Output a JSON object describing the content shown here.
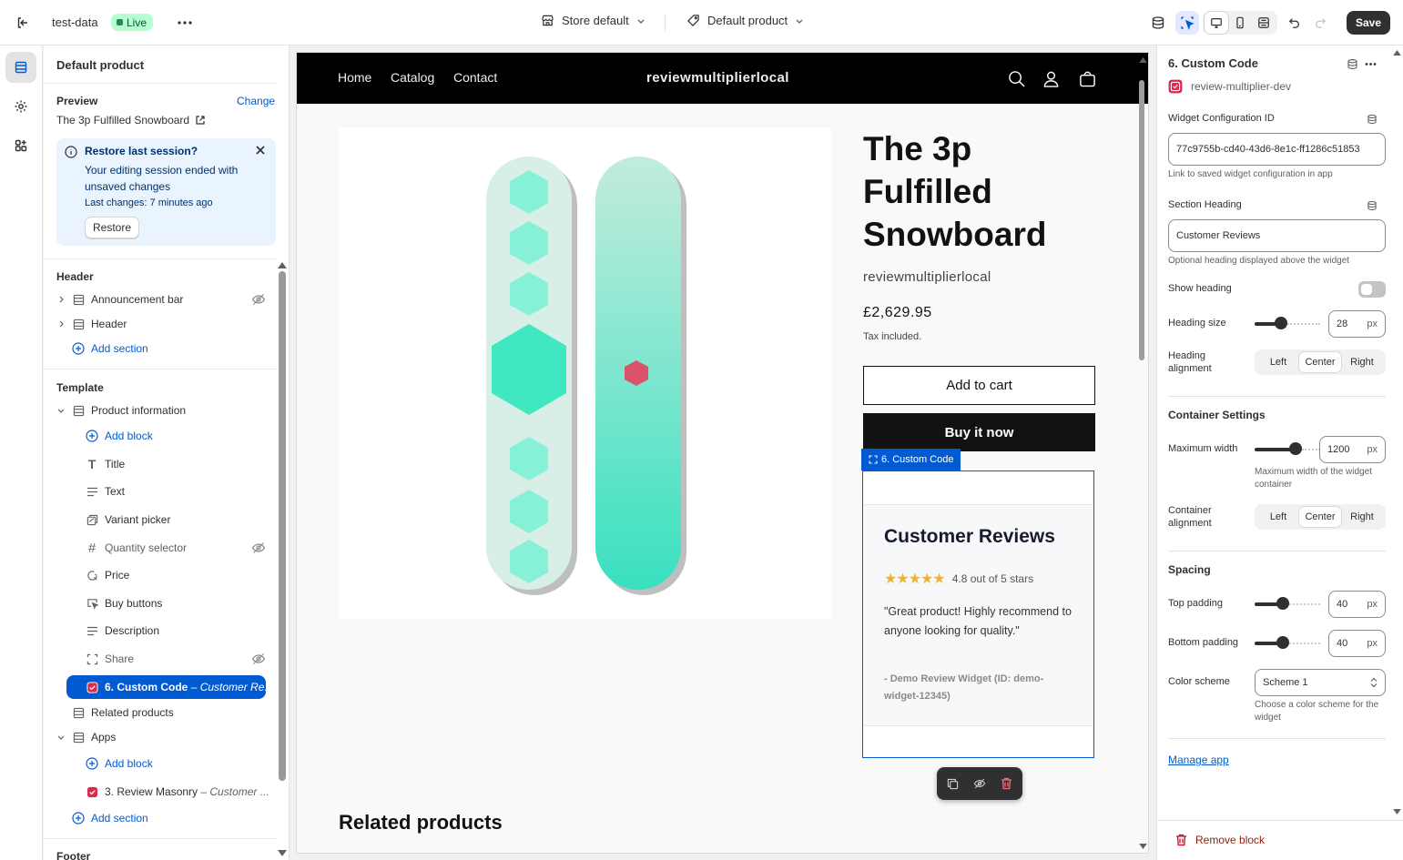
{
  "topbar": {
    "store_name": "test-data",
    "status_badge": "Live",
    "store_selector": "Store default",
    "template_selector": "Default product",
    "save_label": "Save"
  },
  "left_panel": {
    "title": "Default product",
    "preview_label": "Preview",
    "change_link": "Change",
    "preview_product": "The 3p Fulfilled Snowboard",
    "notice": {
      "title": "Restore last session?",
      "body": "Your editing session ended with unsaved changes",
      "meta": "Last changes: 7 minutes ago",
      "button": "Restore"
    },
    "header_group": {
      "title": "Header",
      "items": [
        "Announcement bar",
        "Header"
      ],
      "add_section": "Add section"
    },
    "template_group": {
      "title": "Template",
      "section": "Product information",
      "add_block": "Add block",
      "blocks": [
        "Title",
        "Text",
        "Variant picker",
        "Quantity selector",
        "Price",
        "Buy buttons",
        "Description",
        "Share"
      ],
      "selected_block": "6. Custom Code",
      "selected_block_sub": "Customer Re...",
      "related": "Related products",
      "apps": "Apps",
      "apps_add_block": "Add block",
      "app_block": "3. Review Masonry",
      "app_block_sub": "Customer ...",
      "add_section": "Add section"
    },
    "footer_group": {
      "title": "Footer"
    }
  },
  "preview": {
    "nav_links": [
      "Home",
      "Catalog",
      "Contact"
    ],
    "store_name": "reviewmultiplierlocal",
    "product_title": "The 3p Fulfilled Snowboard",
    "vendor": "reviewmultiplierlocal",
    "price": "£2,629.95",
    "tax_note": "Tax included.",
    "add_to_cart": "Add to cart",
    "buy_now": "Buy it now",
    "custom_code_tag": "6. Custom Code",
    "widget": {
      "heading": "Customer Reviews",
      "stars": "★★★★★",
      "rating_text": "4.8 out of 5 stars",
      "quote": "\"Great product! Highly recommend to anyone looking for quality.\"",
      "attribution": "- Demo Review Widget (ID: demo-widget-12345)"
    },
    "related_heading": "Related products"
  },
  "right_panel": {
    "title": "6. Custom Code",
    "app_name": "review-multiplier-dev",
    "widget_config_label": "Widget Configuration ID",
    "widget_config_value": "77c9755b-cd40-43d6-8e1c-ff1286c51853",
    "widget_config_help": "Link to saved widget configuration in app",
    "section_heading_label": "Section Heading",
    "section_heading_value": "Customer Reviews",
    "section_heading_help": "Optional heading displayed above the widget",
    "show_heading_label": "Show heading",
    "heading_size_label": "Heading size",
    "heading_size_value": "28",
    "heading_size_level": 0.4,
    "unit_px": "px",
    "heading_alignment_label": "Heading alignment",
    "alignment_options": [
      "Left",
      "Center",
      "Right"
    ],
    "container_settings": "Container Settings",
    "max_width_label": "Maximum width",
    "max_width_value": "1200",
    "max_width_level": 0.62,
    "max_width_help": "Maximum width of the widget container",
    "container_alignment_label": "Container alignment",
    "spacing": "Spacing",
    "top_padding_label": "Top padding",
    "top_padding_value": "40",
    "top_padding_level": 0.43,
    "bottom_padding_label": "Bottom padding",
    "bottom_padding_value": "40",
    "bottom_padding_level": 0.43,
    "color_scheme_label": "Color scheme",
    "color_scheme_value": "Scheme 1",
    "color_scheme_help": "Choose a color scheme for the widget",
    "manage_app": "Manage app",
    "remove_block": "Remove block"
  },
  "colors": {
    "accent": "#005bd3",
    "live_badge": "#b4fed2",
    "danger": "#c70a24",
    "star": "#e8b53c"
  }
}
